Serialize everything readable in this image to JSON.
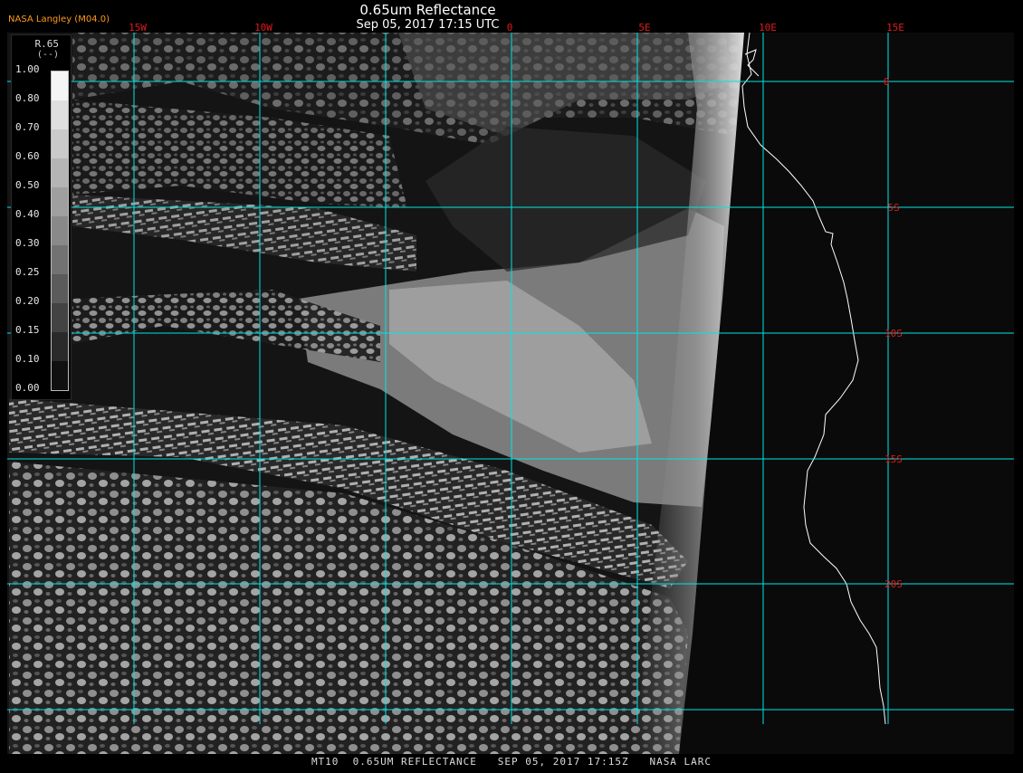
{
  "header": {
    "title": "0.65um Reflectance",
    "subtitle": "Sep 05, 2017 17:15 UTC",
    "source": "NASA Langley (M04.0)"
  },
  "legend": {
    "label_top": "R.65",
    "label_unit": "(--)",
    "ticks": [
      "1.00",
      "0.80",
      "0.70",
      "0.60",
      "0.50",
      "0.40",
      "0.30",
      "0.25",
      "0.20",
      "0.15",
      "0.10",
      "0.00"
    ]
  },
  "axes": {
    "longitude_labels": [
      "15W",
      "10W",
      "0",
      "5E",
      "10E",
      "15E"
    ],
    "latitude_labels": [
      "0",
      "5S",
      "10S",
      "15S",
      "20S"
    ]
  },
  "footer": {
    "text": "MT10  0.65UM REFLECTANCE   SEP 05, 2017 17:15Z   NASA LARC"
  },
  "colors": {
    "grid": "#00e5e5",
    "lon_label": "#e01a1a",
    "lat_label": "#e01a1a",
    "coastline": "#ffffff",
    "source_text": "#ff9a1c"
  }
}
